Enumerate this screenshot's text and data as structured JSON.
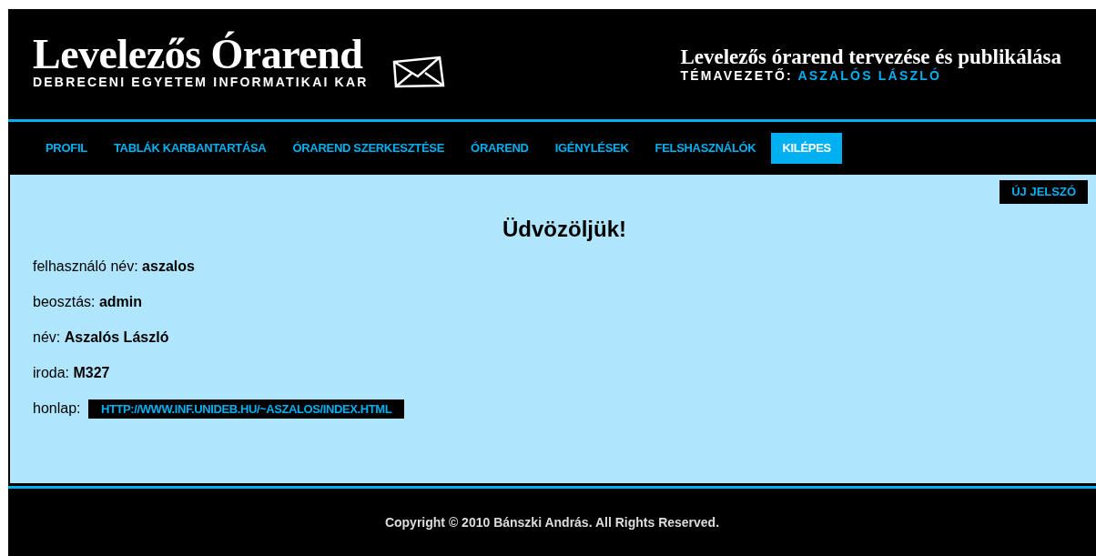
{
  "header": {
    "title": "Levelezős Órarend",
    "subtitle": "DEBRECENI EGYETEM INFORMATIKAI KAR",
    "project": "Levelezős órarend tervezése és publikálása",
    "supervisor_label": "TÉMAVEZETŐ:",
    "supervisor": "ASZALÓS LÁSZLÓ"
  },
  "nav": [
    {
      "label": "PROFIL",
      "selected": false
    },
    {
      "label": "TABLÁK KARBANTARTÁSA",
      "selected": false
    },
    {
      "label": "ÓRAREND SZERKESZTÉSE",
      "selected": false
    },
    {
      "label": "ÓRAREND",
      "selected": false
    },
    {
      "label": "IGÉNYLÉSEK",
      "selected": false
    },
    {
      "label": "FELSHASZNÁLÓK",
      "selected": false
    },
    {
      "label": "KILÉPES",
      "selected": true
    }
  ],
  "new_password_button": "ÚJ JELSZÓ",
  "heading": "Üdvözöljük!",
  "fields": [
    {
      "kind": "text",
      "label": "felhasználó név:",
      "value": "aszalos"
    },
    {
      "kind": "text",
      "label": "beosztás:",
      "value": "admin"
    },
    {
      "kind": "text",
      "label": "név:",
      "value": "Aszalós László"
    },
    {
      "kind": "text",
      "label": "iroda:",
      "value": "M327"
    },
    {
      "kind": "link",
      "label": "honlap:",
      "value": "HTTP://WWW.INF.UNIDEB.HU/~ASZALOS/INDEX.HTML"
    }
  ],
  "footer": "Copyright © 2010 Bánszki András. All Rights Reserved."
}
